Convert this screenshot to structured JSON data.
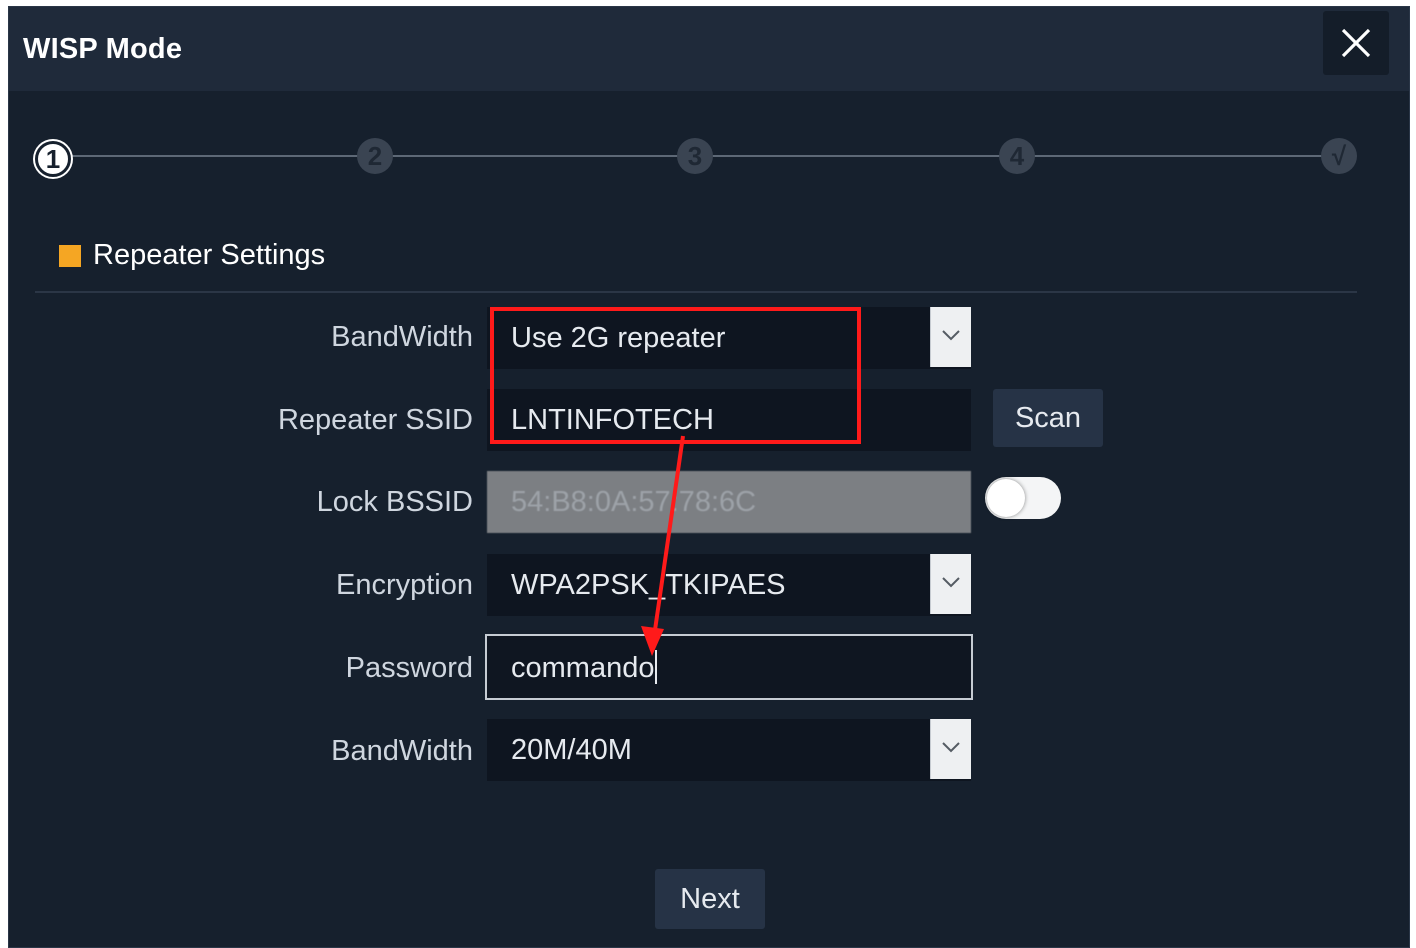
{
  "dialog": {
    "title": "WISP Mode",
    "close_icon": "close-icon"
  },
  "stepper": {
    "steps": [
      "1",
      "2",
      "3",
      "4",
      "√"
    ],
    "active_index": 0
  },
  "section": {
    "title": "Repeater Settings",
    "marker_color": "#f5a623"
  },
  "form": {
    "band_select": {
      "label": "BandWidth",
      "value": "Use 2G repeater"
    },
    "ssid": {
      "label": "Repeater SSID",
      "value": "LNTINFOTECH",
      "scan_label": "Scan"
    },
    "bssid": {
      "label": "Lock BSSID",
      "value": "54:B8:0A:57:78:6C",
      "toggle_on": false
    },
    "encryption": {
      "label": "Encryption",
      "value": "WPA2PSK_TKIPAES"
    },
    "password": {
      "label": "Password",
      "value": "commando"
    },
    "bandwidth": {
      "label": "BandWidth",
      "value": "20M/40M"
    }
  },
  "footer": {
    "next_label": "Next"
  },
  "annotation_color": "#ff1a1a"
}
